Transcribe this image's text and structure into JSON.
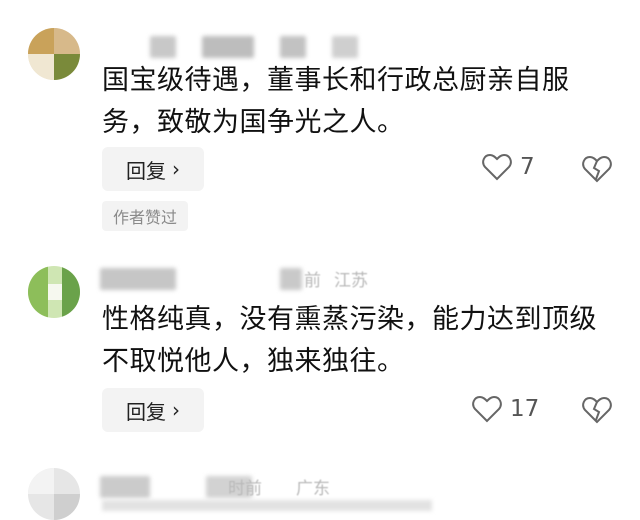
{
  "comments": [
    {
      "avatar_colors": [
        "#c9a25a",
        "#7a8a3a",
        "#e9dcc0"
      ],
      "location": "",
      "time": "",
      "text": "国宝级待遇，董事长和行政总厨亲自服务，致敬为国争光之人。",
      "reply_label": "回复",
      "likes": "7",
      "badge": "作者赞过"
    },
    {
      "avatar_colors": [
        "#8dbe5a",
        "#cfe6b3",
        "#6aa24a"
      ],
      "location": "江苏",
      "time": "前",
      "text": "性格纯真，没有熏蒸污染，能力达到顶级不取悦他人，独来独往。",
      "reply_label": "回复",
      "likes": "17"
    },
    {
      "avatar_colors": [
        "#e6e6e6",
        "#cfcfcf",
        "#f3f3f3"
      ],
      "location": "广东",
      "time": "时前"
    }
  ],
  "colors": {
    "background": "#ffffff",
    "text": "#111111",
    "muted": "#8a8a8a",
    "button_bg": "#f3f3f3"
  },
  "icons": {
    "like": "heart-outline-icon",
    "dislike": "broken-heart-icon",
    "reply": "chevron-right-icon"
  }
}
